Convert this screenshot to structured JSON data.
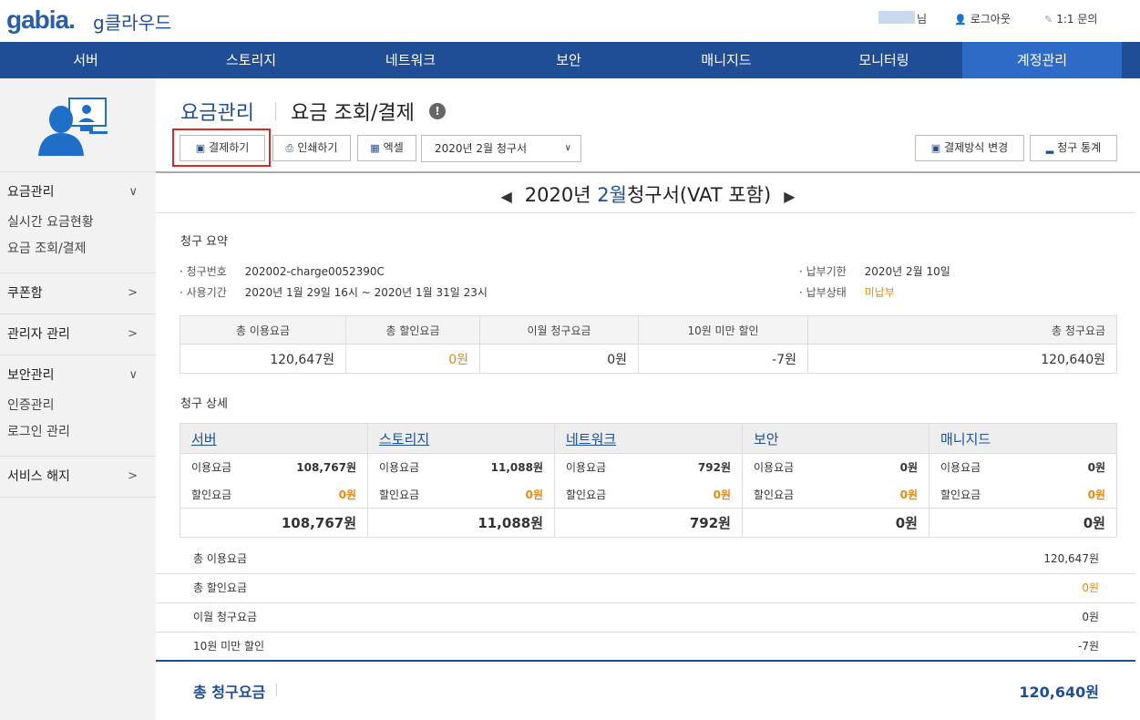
{
  "header": {
    "logo": "gabia.",
    "service": "g클라우드",
    "user_suffix": "님",
    "logout": "로그아웃",
    "inquiry": "1:1 문의"
  },
  "nav": [
    "서버",
    "스토리지",
    "네트워크",
    "보안",
    "매니지드",
    "모니터링",
    "계정관리"
  ],
  "sidebar": {
    "sections": [
      {
        "label": "요금관리",
        "expanded": true,
        "items": [
          "실시간 요금현황",
          "요금 조회/결제"
        ]
      },
      {
        "label": "쿠폰함",
        "expanded": false,
        "items": []
      },
      {
        "label": "관리자 관리",
        "expanded": false,
        "items": []
      },
      {
        "label": "보안관리",
        "expanded": true,
        "items": [
          "인증관리",
          "로그인 관리"
        ]
      },
      {
        "label": "서비스 해지",
        "expanded": false,
        "items": []
      }
    ]
  },
  "page": {
    "title": "요금관리",
    "subtitle": "요금 조회/결제",
    "help": "!",
    "pay_btn": "결제하기",
    "print_btn": "인쇄하기",
    "excel_btn": "엑셀",
    "select_value": "2020년 2월 청구서",
    "change_method_btn": "결제방식 변경",
    "stats_btn": "청구 통계",
    "month_pre": "2020년 ",
    "month_num": "2월",
    "month_post": "청구서(VAT 포함)"
  },
  "summary": {
    "title": "청구 요약",
    "bill_no_label": "청구번호",
    "bill_no": "202002-charge0052390C",
    "period_label": "사용기간",
    "period": "2020년 1월 29일 16시 ~ 2020년 1월 31일 23시",
    "due_label": "납부기한",
    "due": "2020년 2월 10일",
    "status_label": "납부상태",
    "status": "미납부",
    "headers": [
      "총 이용요금",
      "총 할인요금",
      "이월 청구요금",
      "10원 미만 할인",
      "총 청구요금"
    ],
    "values": [
      "120,647원",
      "0원",
      "0원",
      "-7원",
      "120,640원"
    ]
  },
  "detail": {
    "title": "청구 상세",
    "usage_label": "이용요금",
    "discount_label": "할인요금",
    "columns": [
      {
        "name": "서버",
        "usage": "108,767원",
        "discount": "0원",
        "total": "108,767원"
      },
      {
        "name": "스토리지",
        "usage": "11,088원",
        "discount": "0원",
        "total": "11,088원"
      },
      {
        "name": "네트워크",
        "usage": "792원",
        "discount": "0원",
        "total": "792원"
      },
      {
        "name": "보안",
        "usage": "0원",
        "discount": "0원",
        "total": "0원"
      },
      {
        "name": "매니지드",
        "usage": "0원",
        "discount": "0원",
        "total": "0원"
      }
    ]
  },
  "lines": [
    {
      "label": "총 이용요금",
      "value": "120,647원"
    },
    {
      "label": "총 할인요금",
      "value": "0원"
    },
    {
      "label": "이월 청구요금",
      "value": "0원"
    },
    {
      "label": "10원 미만 할인",
      "value": "-7원"
    }
  ],
  "grand": {
    "label": "총 청구요금",
    "value": "120,640원"
  }
}
